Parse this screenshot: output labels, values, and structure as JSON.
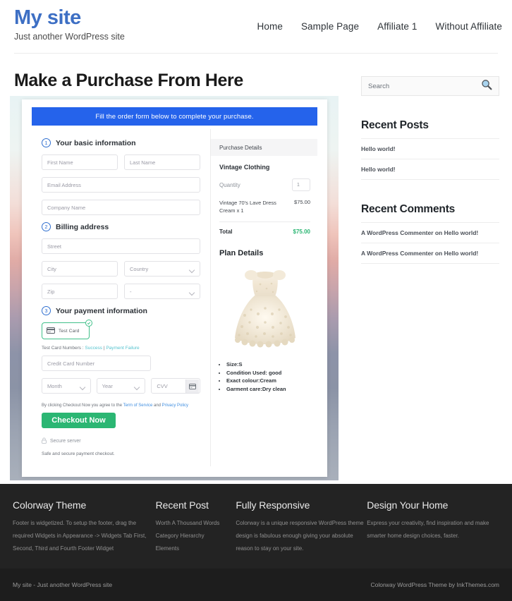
{
  "header": {
    "brand_title": "My site",
    "brand_tagline": "Just another WordPress site",
    "nav": [
      {
        "label": "Home"
      },
      {
        "label": "Sample Page"
      },
      {
        "label": "Affiliate 1"
      },
      {
        "label": "Without Affiliate"
      }
    ]
  },
  "main": {
    "page_title": "Make a Purchase From Here",
    "form": {
      "banner": "Fill the order form below to complete your purchase.",
      "steps": [
        {
          "num": "1",
          "label": "Your basic information"
        },
        {
          "num": "2",
          "label": "Billing address"
        },
        {
          "num": "3",
          "label": "Your payment information"
        }
      ],
      "fields": {
        "first_name": "First Name",
        "last_name": "Last Name",
        "email": "Email Address",
        "company": "Company Name",
        "street": "Street",
        "city": "City",
        "country": "Country",
        "zip": "Zip",
        "state": "-",
        "credit_card": "Credit Card Number",
        "month": "Month",
        "year": "Year",
        "cvv": "CVV"
      },
      "card_tab_label": "Test Card",
      "test_card_prefix": "Test Card Numbers : ",
      "test_card_success": "Success",
      "test_card_divider": " | ",
      "test_card_failure": "Payment Failure",
      "terms_prefix": "By clicking Checkout Now you agree to the ",
      "terms_tos": "Term of Service",
      "terms_and": " and ",
      "terms_privacy": "Privacy Policy",
      "checkout_label": "Checkout Now",
      "secure_server": "Secure server",
      "safe_note": "Safe and secure payment checkout."
    },
    "purchase_details": {
      "header": "Purchase Details",
      "product_title": "Vintage Clothing",
      "quantity_label": "Quantity",
      "quantity_value": "1",
      "item_name": "Vintage 70's Lave Dress Cream x 1",
      "item_price": "$75.00",
      "total_label": "Total",
      "total_value": "$75.00"
    },
    "plan_details": {
      "title": "Plan Details",
      "bullets": [
        "Size:S",
        "Condition Used: good",
        "Exact colour:Cream",
        "Garment care:Dry clean"
      ]
    }
  },
  "sidebar": {
    "search_placeholder": "Search",
    "widgets": [
      {
        "title": "Recent Posts",
        "items": [
          "Hello world!",
          "Hello world!"
        ]
      },
      {
        "title": "Recent Comments",
        "items": [
          "A WordPress Commenter on Hello world!",
          "A WordPress Commenter on Hello world!"
        ]
      }
    ]
  },
  "footer": {
    "columns": [
      {
        "heading": "Colorway Theme",
        "text": "Footer is widgetized. To setup the footer, drag the required Widgets in Appearance -> Widgets Tab First, Second, Third and Fourth Footer Widget"
      },
      {
        "heading": "Recent Post",
        "links": [
          "Worth A Thousand Words",
          "Category Hierarchy",
          "Elements"
        ]
      },
      {
        "heading": "Fully Responsive",
        "text": "Colorway is a unique responsive WordPress theme design is fabulous enough giving your absolute reason to stay on your site."
      },
      {
        "heading": "Design Your Home",
        "text": "Express your creativity, find inspiration and make smarter home design choices, faster."
      }
    ],
    "copyright_left": "My site - Just another WordPress site",
    "copyright_right": "Colorway WordPress Theme by InkThemes.com"
  },
  "colors": {
    "brand": "#3d6fc4",
    "banner_blue": "#2563eb",
    "checkout_green": "#2bb673",
    "total_green": "#2bb673",
    "footer_dark": "#232323"
  }
}
